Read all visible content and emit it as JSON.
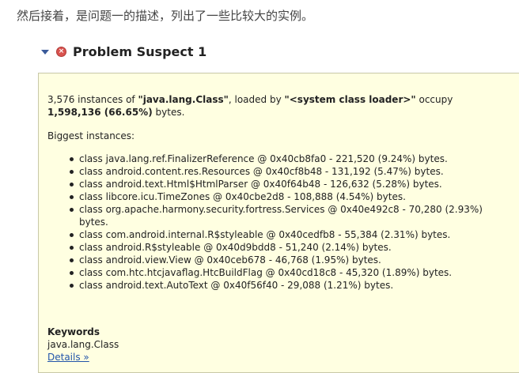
{
  "intro_text": "然后接着，是问题一的描述，列出了一些比较大的实例。",
  "suspect": {
    "title": "Problem Suspect 1",
    "error_icon_glyph": "×"
  },
  "summary": {
    "count": "3,576",
    "text_instances_of": " instances of ",
    "class_name": "\"java.lang.Class\"",
    "text_loaded_by": ", loaded by ",
    "loader": "\"<system class loader>\"",
    "text_occupy": " occupy",
    "bytes": "1,598,136 (66.65%)",
    "text_bytes": " bytes."
  },
  "biggest_label": "Biggest instances:",
  "instances": [
    "class java.lang.ref.FinalizerReference @ 0x40cb8fa0 - 221,520 (9.24%) bytes.",
    "class android.content.res.Resources @ 0x40cf8b48 - 131,192 (5.47%) bytes.",
    "class android.text.Html$HtmlParser @ 0x40f64b48 - 126,632 (5.28%) bytes.",
    "class libcore.icu.TimeZones @ 0x40cbe2d8 - 108,888 (4.54%) bytes.",
    "class org.apache.harmony.security.fortress.Services @ 0x40e492c8 - 70,280 (2.93%) bytes.",
    "class com.android.internal.R$styleable @ 0x40cedfb8 - 55,384 (2.31%) bytes.",
    "class android.R$styleable @ 0x40d9bdd8 - 51,240 (2.14%) bytes.",
    "class android.view.View @ 0x40ceb678 - 46,768 (1.95%) bytes.",
    "class com.htc.htcjavaflag.HtcBuildFlag @ 0x40cd18c8 - 45,320 (1.89%) bytes.",
    "class android.text.AutoText @ 0x40f56f40 - 29,088 (1.21%) bytes."
  ],
  "keywords": {
    "label": "Keywords",
    "value": "java.lang.Class"
  },
  "details_link": "Details »",
  "colors": {
    "panel_bg": "#ffffe1",
    "link": "#2255aa",
    "error_icon": "#d9534f"
  }
}
